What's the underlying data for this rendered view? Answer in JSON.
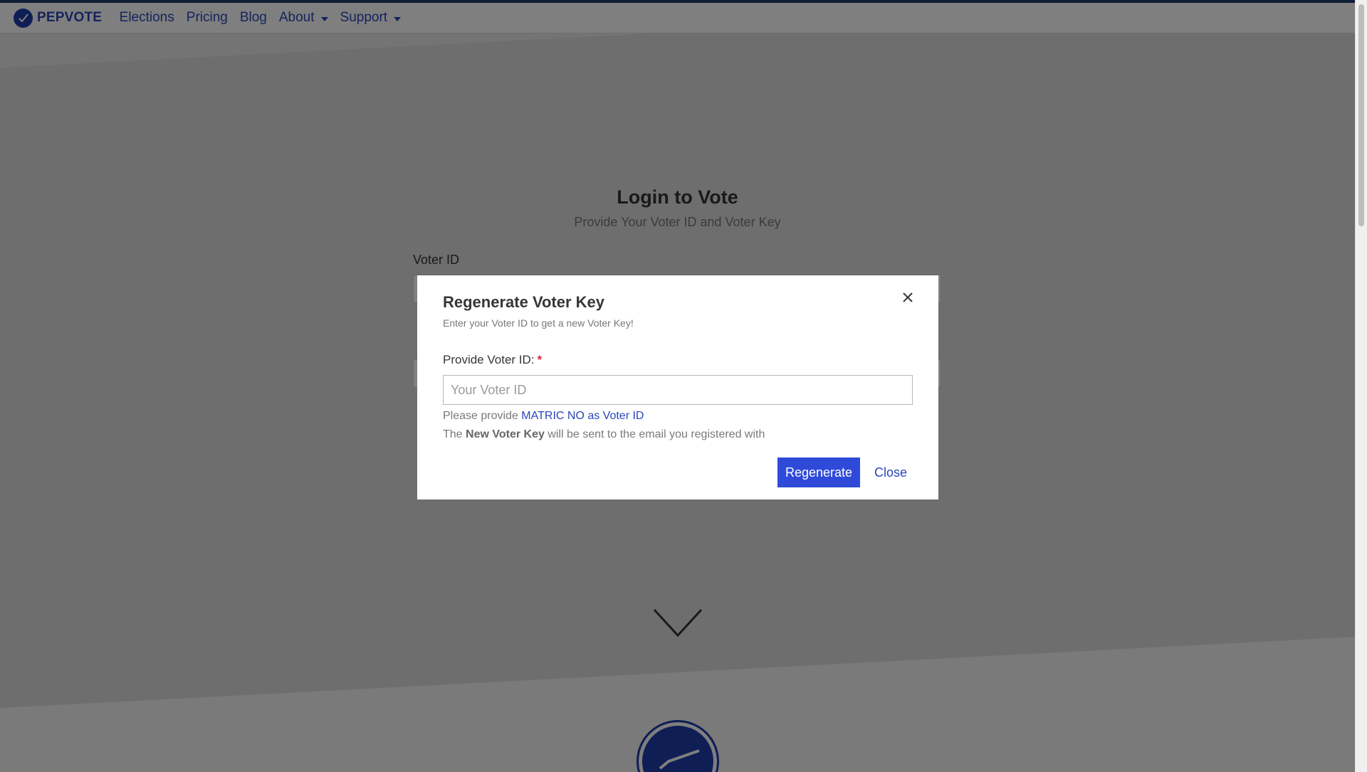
{
  "navbar": {
    "brand": "PEPVOTE",
    "items": [
      {
        "label": "Elections",
        "dropdown": false
      },
      {
        "label": "Pricing",
        "dropdown": false
      },
      {
        "label": "Blog",
        "dropdown": false
      },
      {
        "label": "About",
        "dropdown": true
      },
      {
        "label": "Support",
        "dropdown": true
      }
    ]
  },
  "login": {
    "title": "Login to Vote",
    "subtitle": "Provide Your Voter ID and Voter Key",
    "voter_id_label": "Voter ID"
  },
  "modal": {
    "title": "Regenerate Voter Key",
    "subtitle": "Enter your Voter ID to get a new Voter Key!",
    "field_label": "Provide Voter ID:",
    "required_mark": "*",
    "input_value": "",
    "input_placeholder": "Your Voter ID",
    "help_prefix": "Please provide ",
    "help_link": "MATRIC NO as Voter ID",
    "help2_prefix": "The ",
    "help2_bold": "New Voter Key",
    "help2_suffix": " will be sent to the email you registered with",
    "regenerate_label": "Regenerate",
    "close_label": "Close"
  },
  "colors": {
    "brand_blue": "#2a46b8",
    "button_blue": "#2f4ad9",
    "required_red": "#e0263c",
    "nav_top_line": "#1f3a6b"
  }
}
